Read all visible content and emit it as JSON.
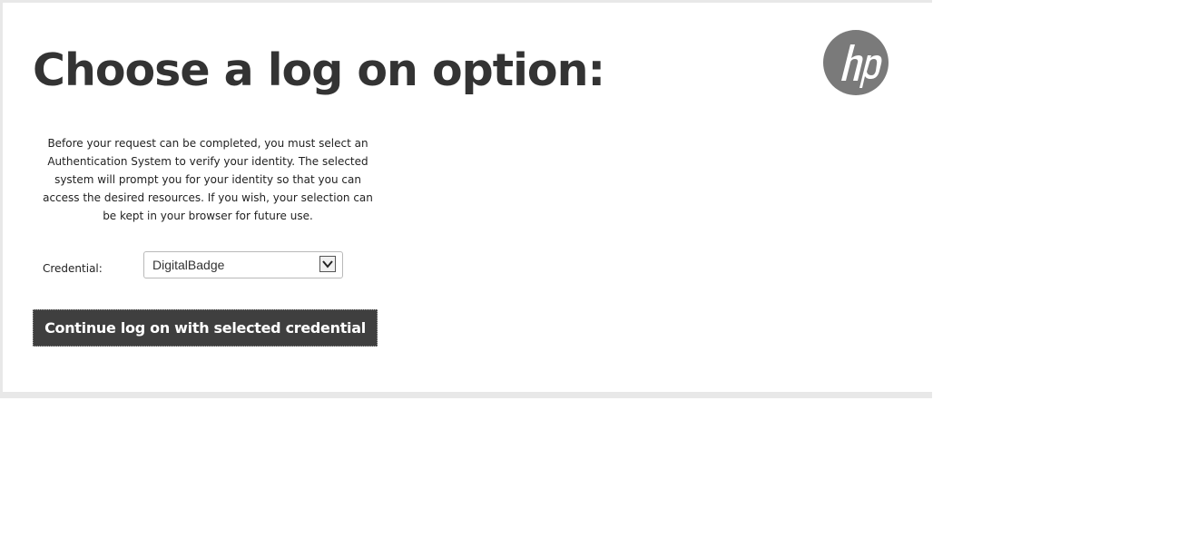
{
  "page": {
    "title": "Choose a log on option:"
  },
  "logo": {
    "text": "hp",
    "color": "#7a7a7a"
  },
  "intro": {
    "text": "Before your request can be completed, you must select an Authentication System to verify your identity. The selected system will prompt you for your identity so that you can access the desired resources. If you wish, your selection can be kept in your browser for future use."
  },
  "credential": {
    "label": "Credential:",
    "selected": "DigitalBadge",
    "icon": "chevron-down-icon"
  },
  "actions": {
    "continue_label": "Continue log on with selected credential"
  },
  "colors": {
    "text_dark": "#333333",
    "button_bg": "#3f3f3f",
    "frame": "#e8e8e8"
  }
}
